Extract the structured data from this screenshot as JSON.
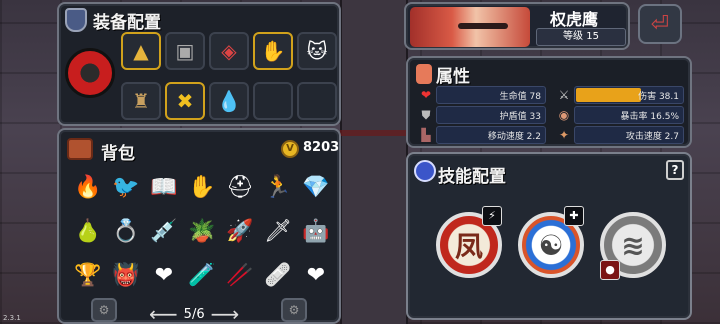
{
  "version": "2.3.1",
  "equipment": {
    "title": "装备配置",
    "weapon_icon": "red-gauntlet-icon",
    "slots": [
      {
        "icon": "pyramid-icon",
        "glyph": "▲"
      },
      {
        "icon": "cassette-icon",
        "glyph": "▣"
      },
      {
        "icon": "machine-icon",
        "glyph": "◈"
      },
      {
        "icon": "golden-claw-icon",
        "glyph": "✋"
      },
      {
        "icon": "lucky-cat-icon",
        "glyph": "🐱"
      },
      {
        "icon": "character-figure-icon",
        "glyph": "♜"
      },
      {
        "icon": "crossed-coin-icon",
        "glyph": "✖"
      },
      {
        "icon": "oil-drop-icon",
        "glyph": "💧"
      },
      {
        "icon": "empty-slot",
        "glyph": ""
      },
      {
        "icon": "empty-slot",
        "glyph": ""
      }
    ]
  },
  "backpack": {
    "title": "背包",
    "coins": "8203",
    "page": "5/6",
    "items": [
      "🔥",
      "🐦",
      "📖",
      "✋",
      "⛑",
      "🏃",
      "💎",
      "🍐",
      "💍",
      "💉",
      "🪴",
      "🚀",
      "🗡",
      "🤖",
      "🏆",
      "👹",
      "❤",
      "🧪",
      "🥢",
      "🩹",
      "❤"
    ]
  },
  "character": {
    "name": "权虎鹰",
    "level": "等级 15"
  },
  "attributes": {
    "title": "属性",
    "stats": [
      {
        "label": "生命值 78",
        "icon": "heart-icon"
      },
      {
        "label": "伤害 38.1",
        "icon": "sword-icon",
        "bar": 0.6
      },
      {
        "label": "护盾值 33",
        "icon": "shield-icon"
      },
      {
        "label": "暴击率 16.5%",
        "icon": "crit-eye-icon"
      },
      {
        "label": "移动速度 2.2",
        "icon": "boot-icon"
      },
      {
        "label": "攻击速度 2.7",
        "icon": "attack-speed-icon"
      }
    ]
  },
  "skills": {
    "title": "技能配置",
    "help": "?",
    "items": [
      {
        "glyph": "凤",
        "icon": "phoenix-skill-icon"
      },
      {
        "glyph": "☯",
        "icon": "meditation-skill-icon"
      },
      {
        "glyph": "≋",
        "icon": "cloud-skill-icon"
      }
    ]
  }
}
